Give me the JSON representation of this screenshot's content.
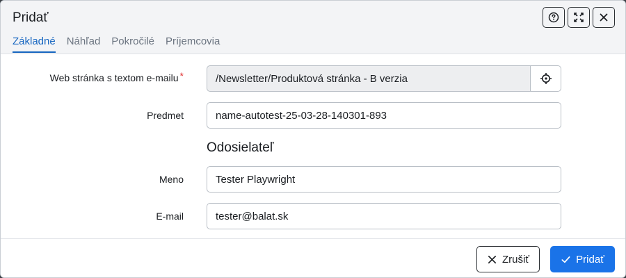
{
  "dialog": {
    "title": "Pridať"
  },
  "tabs": [
    {
      "label": "Základné",
      "active": true
    },
    {
      "label": "Náhľad",
      "active": false
    },
    {
      "label": "Pokročilé",
      "active": false
    },
    {
      "label": "Príjemcovia",
      "active": false
    }
  ],
  "form": {
    "web_page": {
      "label": "Web stránka s textom e-mailu",
      "required_mark": "*",
      "value": "/Newsletter/Produktová stránka - B verzia"
    },
    "subject": {
      "label": "Predmet",
      "value": "name-autotest-25-03-28-140301-893"
    },
    "sender_section": "Odosielateľ",
    "name": {
      "label": "Meno",
      "value": "Tester Playwright"
    },
    "email": {
      "label": "E-mail",
      "value": "tester@balat.sk"
    }
  },
  "footer": {
    "cancel_label": "Zrušiť",
    "save_label": "Pridať"
  },
  "icons": {
    "help": "help-circle-icon",
    "maximize": "maximize-icon",
    "close": "close-icon",
    "picker": "crosshair-icon",
    "cancel": "x-icon",
    "save": "check-icon"
  },
  "colors": {
    "accent": "#1a73e8",
    "required": "#e03131",
    "active_tab": "#1565c0"
  }
}
